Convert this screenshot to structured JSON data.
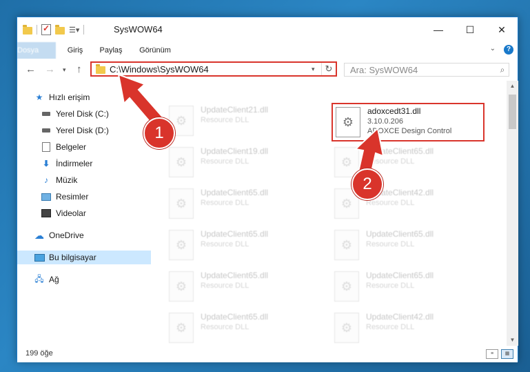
{
  "window": {
    "title": "SysWOW64",
    "buttons": {
      "minimize": "—",
      "maximize": "☐",
      "close": "✕"
    }
  },
  "ribbon": {
    "tabs": [
      "Dosya",
      "Giriş",
      "Paylaş",
      "Görünüm"
    ]
  },
  "navigation": {
    "address_path": "C:\\Windows\\SysWOW64",
    "search_placeholder": "Ara: SysWOW64"
  },
  "sidebar": {
    "items": [
      {
        "label": "Hızlı erişim",
        "icon": "star-icon"
      },
      {
        "label": "Yerel Disk (C:)",
        "icon": "drive-icon"
      },
      {
        "label": "Yerel Disk (D:)",
        "icon": "drive-icon"
      },
      {
        "label": "Belgeler",
        "icon": "documents-icon"
      },
      {
        "label": "İndirmeler",
        "icon": "download-icon"
      },
      {
        "label": "Müzik",
        "icon": "music-icon"
      },
      {
        "label": "Resimler",
        "icon": "pictures-icon"
      },
      {
        "label": "Videolar",
        "icon": "videos-icon"
      },
      {
        "label": "OneDrive",
        "icon": "cloud-icon"
      },
      {
        "label": "Bu bilgisayar",
        "icon": "computer-icon",
        "selected": true
      },
      {
        "label": "Ağ",
        "icon": "network-icon"
      }
    ]
  },
  "files": [
    {
      "name": "UpdateClient21.dll",
      "desc": "Resource DLL"
    },
    {
      "name": "adoxcedt31.dll",
      "version": "3.10.0.206",
      "desc": "ADOXCE Design Control",
      "highlighted": true
    },
    {
      "name": "UpdateClient19.dll",
      "desc": "Resource DLL"
    },
    {
      "name": "UpdateClient65.dll",
      "desc": "Resource DLL"
    },
    {
      "name": "UpdateClient65.dll",
      "desc": "Resource DLL"
    },
    {
      "name": "UpdateClient42.dll",
      "desc": "Resource DLL"
    },
    {
      "name": "UpdateClient65.dll",
      "desc": "Resource DLL"
    },
    {
      "name": "UpdateClient65.dll",
      "desc": "Resource DLL"
    },
    {
      "name": "UpdateClient65.dll",
      "desc": "Resource DLL"
    },
    {
      "name": "UpdateClient65.dll",
      "desc": "Resource DLL"
    },
    {
      "name": "UpdateClient65.dll",
      "desc": "Resource DLL"
    },
    {
      "name": "UpdateClient42.dll",
      "desc": "Resource DLL"
    }
  ],
  "status": {
    "item_count": "199 öğe"
  },
  "annotations": {
    "step1": "1",
    "step2": "2",
    "color": "#d9342b"
  }
}
